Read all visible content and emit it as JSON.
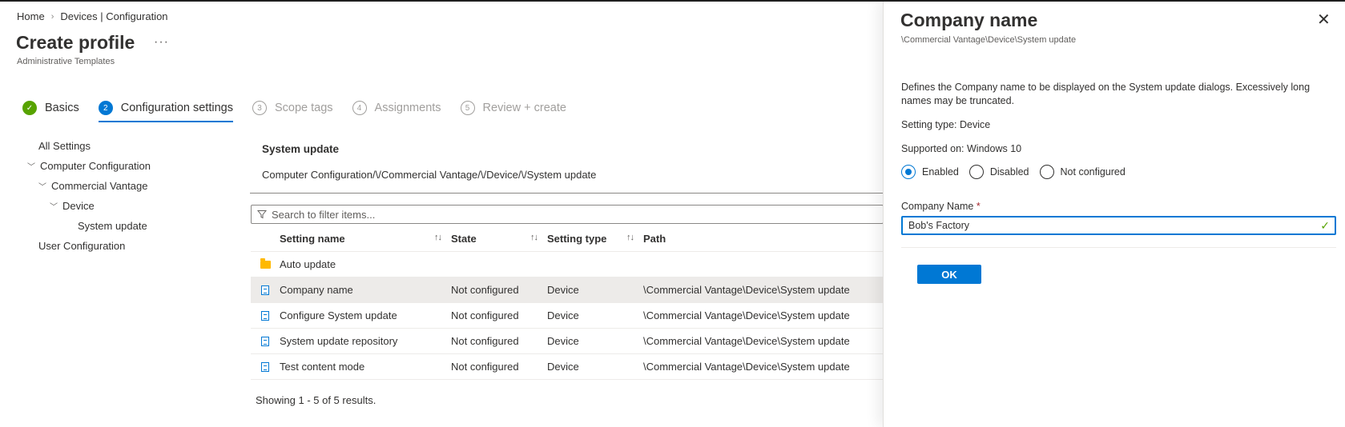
{
  "breadcrumb": {
    "home": "Home",
    "sep": "›",
    "current": "Devices | Configuration"
  },
  "page": {
    "title": "Create profile",
    "more": "···",
    "subtitle": "Administrative Templates"
  },
  "steps": [
    {
      "num": "✓",
      "label": "Basics",
      "state": "done"
    },
    {
      "num": "2",
      "label": "Configuration settings",
      "state": "current"
    },
    {
      "num": "3",
      "label": "Scope tags",
      "state": "future"
    },
    {
      "num": "4",
      "label": "Assignments",
      "state": "future"
    },
    {
      "num": "5",
      "label": "Review + create",
      "state": "future"
    }
  ],
  "tree": {
    "all": "All Settings",
    "computer": "Computer Configuration",
    "vantage": "Commercial Vantage",
    "device": "Device",
    "system_update": "System update",
    "user": "User Configuration",
    "chevron": "﹀"
  },
  "section": {
    "title": "System update",
    "path": "Computer Configuration/\\/Commercial Vantage/\\/Device/\\/System update"
  },
  "filter": {
    "placeholder": "Search to filter items...",
    "icon": "filter-icon"
  },
  "table": {
    "headers": {
      "name": "Setting name",
      "state": "State",
      "type": "Setting type",
      "path": "Path",
      "sort": "↑↓"
    },
    "rows": [
      {
        "name": "Auto update",
        "state": "",
        "type": "",
        "path": "",
        "icon": "folder"
      },
      {
        "name": "Company name",
        "state": "Not configured",
        "type": "Device",
        "path": "\\Commercial Vantage\\Device\\System update",
        "icon": "doc"
      },
      {
        "name": "Configure System update",
        "state": "Not configured",
        "type": "Device",
        "path": "\\Commercial Vantage\\Device\\System update",
        "icon": "doc"
      },
      {
        "name": "System update repository",
        "state": "Not configured",
        "type": "Device",
        "path": "\\Commercial Vantage\\Device\\System update",
        "icon": "doc"
      },
      {
        "name": "Test content mode",
        "state": "Not configured",
        "type": "Device",
        "path": "\\Commercial Vantage\\Device\\System update",
        "icon": "doc"
      }
    ],
    "footer": "Showing 1 - 5 of 5 results."
  },
  "panel": {
    "title": "Company name",
    "subtitle": "\\Commercial Vantage\\Device\\System update",
    "close": "✕",
    "description": "Defines the Company name to be displayed on the System update dialogs. Excessively long names may be truncated.",
    "setting_type": "Setting type: Device",
    "supported": "Supported on: Windows 10",
    "radios": {
      "enabled": "Enabled",
      "disabled": "Disabled",
      "not_configured": "Not configured"
    },
    "field_label": "Company Name",
    "required_mark": "*",
    "field_value": "Bob's Factory",
    "check": "✓",
    "ok": "OK"
  },
  "colors": {
    "accent": "#0078d4",
    "success": "#57a300",
    "folder": "#ffb900"
  }
}
